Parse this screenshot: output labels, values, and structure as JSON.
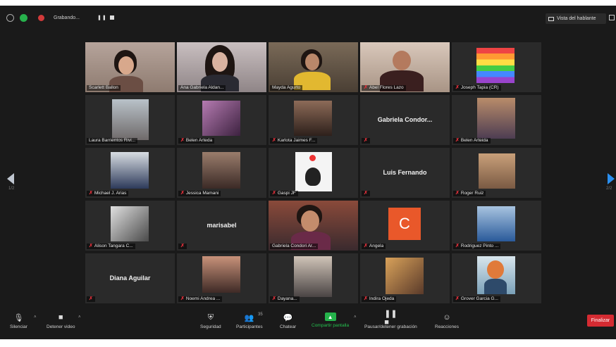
{
  "topbar": {
    "recording_text": "Grabando...",
    "pause_icon": "pause-icon",
    "stop_icon": "stop-icon",
    "speaker_view_label": "Vista del hablante"
  },
  "participants": [
    {
      "name": "Scarlett Ballon",
      "muted": false
    },
    {
      "name": "Ana Gabriela Aldan...",
      "muted": false
    },
    {
      "name": "Mayda Agurto",
      "muted": false,
      "active": true
    },
    {
      "name": "Abel Flores Lazo",
      "muted": true
    },
    {
      "name": "Joseph Tapia (CR)",
      "muted": true
    },
    {
      "name": "Laura Barrientos Rivi...",
      "muted": false
    },
    {
      "name": "Belen Arteda",
      "muted": true
    },
    {
      "name": "Karlota Jaimes F...",
      "muted": true
    },
    {
      "name": "",
      "card_text": "Gabriela Condor...",
      "muted": true
    },
    {
      "name": "Belen Arteida",
      "muted": true
    },
    {
      "name": "Michael J. Arias",
      "muted": true
    },
    {
      "name": "Jessica Mamani",
      "muted": true
    },
    {
      "name": "Gaspi JF",
      "muted": true
    },
    {
      "name": "",
      "card_text": "Luis Fernando",
      "muted": true
    },
    {
      "name": "Roger Ruiz",
      "muted": true
    },
    {
      "name": "Alison Tangara C...",
      "muted": true
    },
    {
      "name": "",
      "card_text": "marisabel",
      "muted": true
    },
    {
      "name": "Gabriela Condori Ar...",
      "muted": false
    },
    {
      "name": "Angela",
      "muted": true,
      "avatar_letter": "C"
    },
    {
      "name": "Rodriguez Pinto ...",
      "muted": true
    },
    {
      "name": "",
      "card_text": "Diana Aguilar",
      "muted": true
    },
    {
      "name": "Noemi Andrea ...",
      "muted": true
    },
    {
      "name": "Dayana...",
      "muted": true
    },
    {
      "name": "Indira Ojeda",
      "muted": true
    },
    {
      "name": "Grover Garcia G...",
      "muted": true
    }
  ],
  "pages": {
    "left": "1/2",
    "right": "2/2"
  },
  "toolbar": {
    "mute": "Silenciar",
    "video": "Detener video",
    "security": "Seguridad",
    "participants": "Participantes",
    "participants_count": "35",
    "chat": "Chatear",
    "share": "Compartir pantalla",
    "record": "Pausar/detener grabación",
    "reactions": "Reacciones",
    "end": "Finalizar"
  },
  "colors": {
    "share_green": "#25b34b",
    "end_red": "#d52b32",
    "active_border": "#c7d84a",
    "avatar_orange": "#e9582a"
  }
}
